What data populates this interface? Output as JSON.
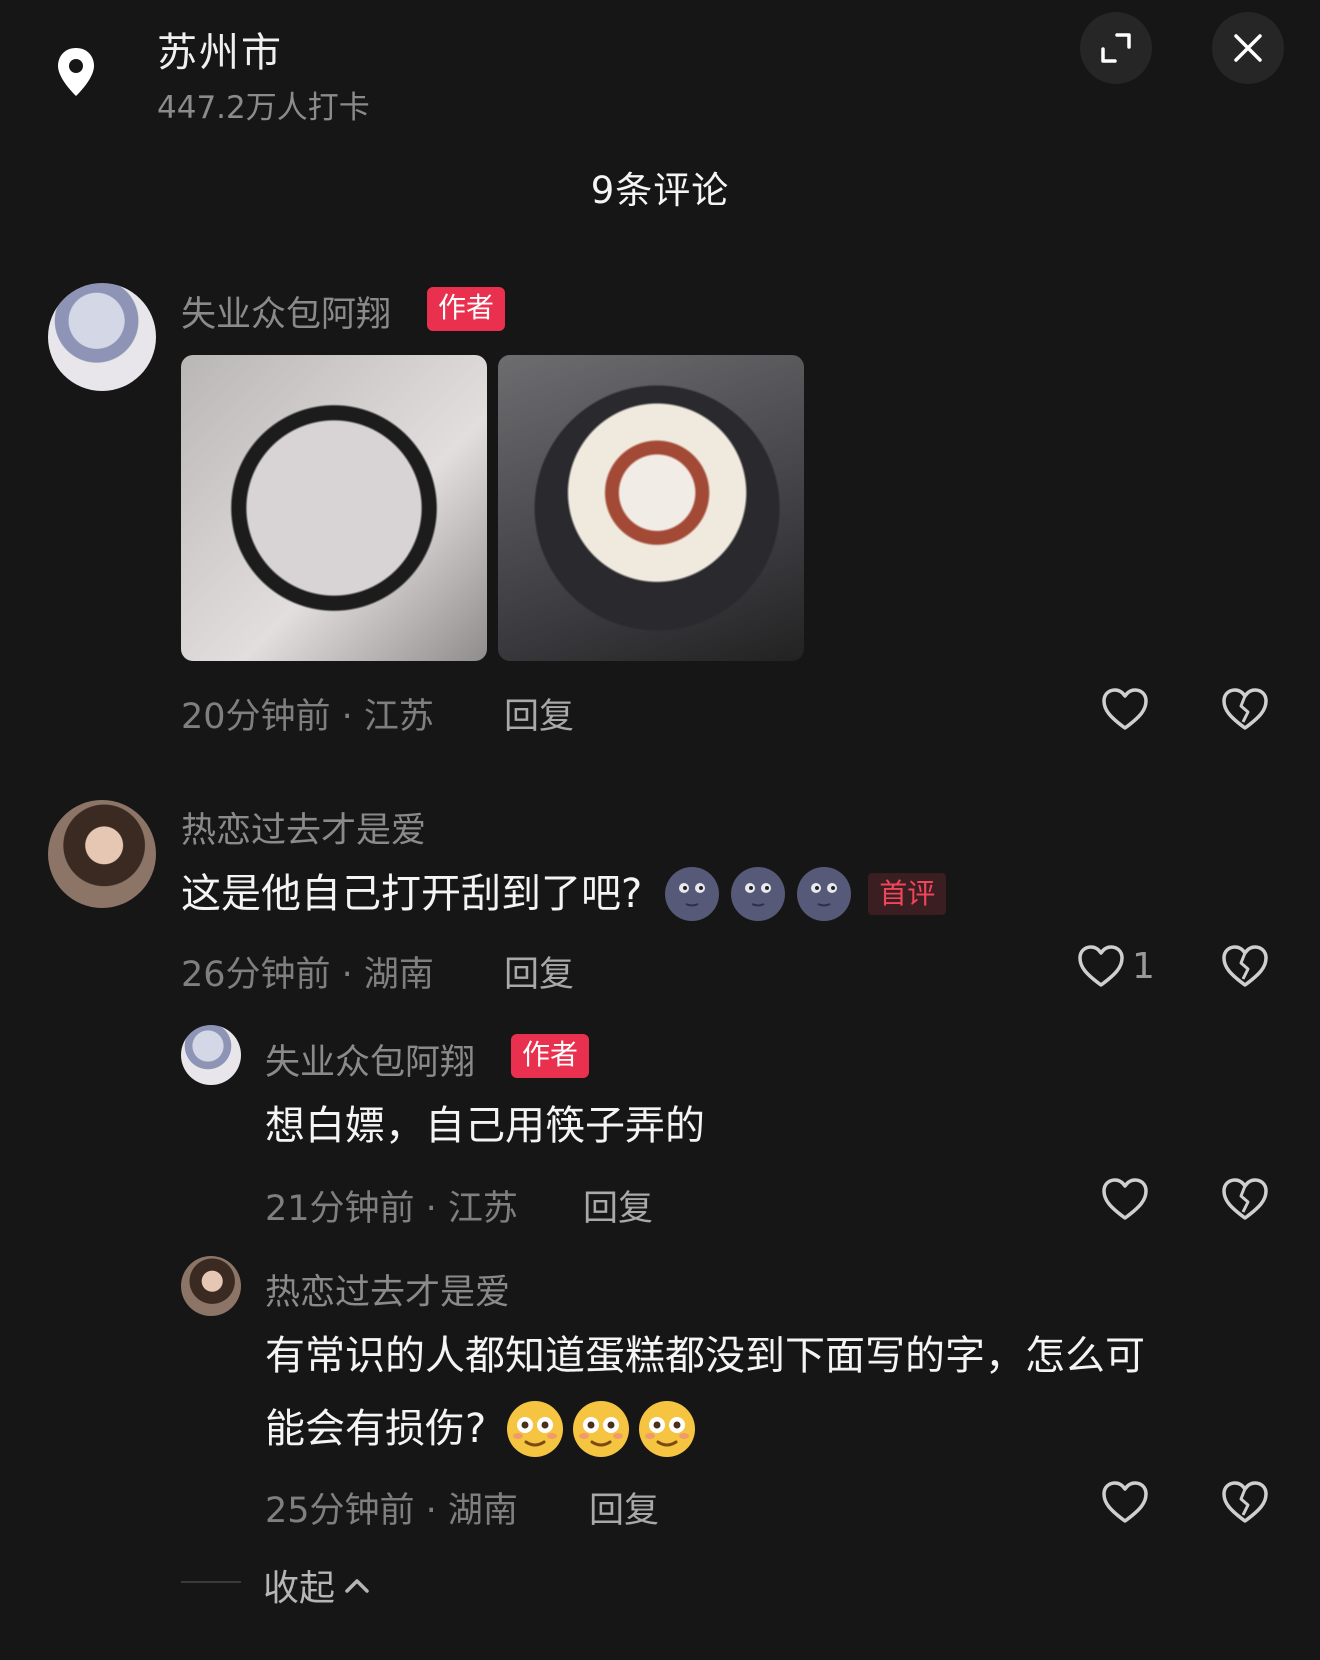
{
  "header": {
    "location_name": "苏州市",
    "checkins": "447.2万人打卡",
    "comment_count_title": "9条评论",
    "icons": [
      "location-pin-icon",
      "expand-icon",
      "close-icon"
    ]
  },
  "comments": [
    {
      "author": "失业众包阿翔",
      "badge": "作者",
      "images": [
        "cake-box-photo",
        "birthday-cake-photo"
      ],
      "meta": "20分钟前 · 江苏",
      "reply_label": "回复",
      "likes": ""
    },
    {
      "author": "热恋过去才是爱",
      "text": "这是他自己打开刮到了吧?",
      "emojis": [
        "moon-face-emoji",
        "moon-face-emoji",
        "moon-face-emoji"
      ],
      "first_badge": "首评",
      "meta": "26分钟前 · 湖南",
      "reply_label": "回复",
      "likes": "1",
      "replies": [
        {
          "author": "失业众包阿翔",
          "badge": "作者",
          "text": "想白嫖，自己用筷子弄的",
          "meta": "21分钟前 · 江苏",
          "reply_label": "回复"
        },
        {
          "author": "热恋过去才是爱",
          "text_line1": "有常识的人都知道蛋糕都没到下面写的字，怎么可",
          "text_line2": "能会有损伤?",
          "emojis": [
            "flushed-face-emoji",
            "flushed-face-emoji",
            "flushed-face-emoji"
          ],
          "meta": "25分钟前 · 湖南",
          "reply_label": "回复"
        }
      ],
      "collapse_label": "收起"
    }
  ],
  "colors": {
    "background": "#161616",
    "author_badge": "#e9314f",
    "first_comment_badge": "#f0455b"
  }
}
